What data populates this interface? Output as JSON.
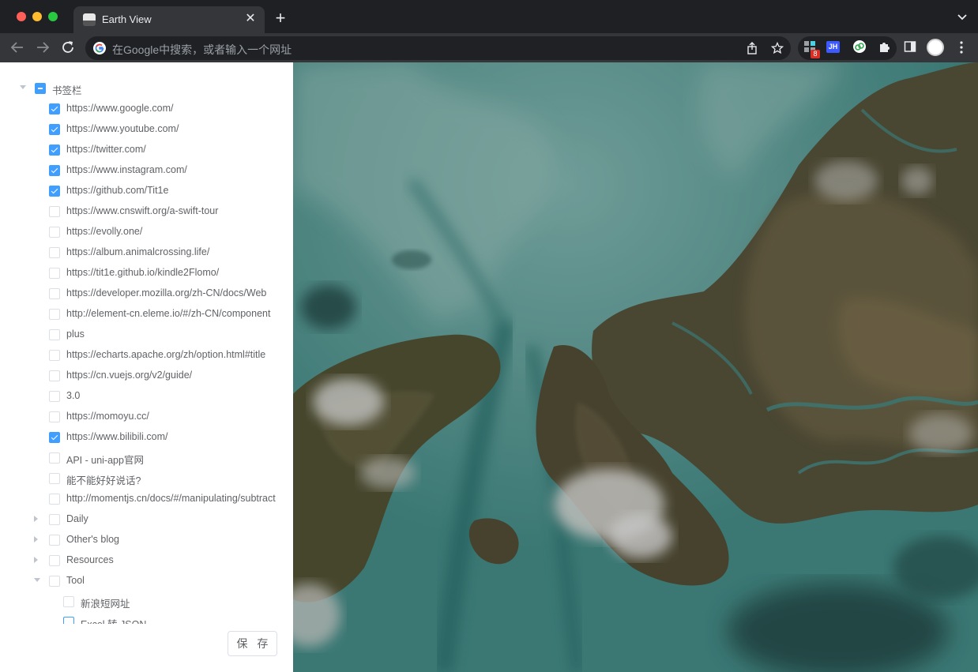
{
  "browser": {
    "tab_title": "Earth View",
    "tab_close": "✕",
    "new_tab": "+",
    "omnibox_placeholder": "在Google中搜索，或者输入一个网址",
    "extension_badge": "8",
    "jh_label": "JH"
  },
  "tree": {
    "root": {
      "label": "书签栏",
      "state": "indeterminate",
      "expanded": true
    },
    "bookmarks": [
      {
        "label": "https://www.google.com/",
        "checked": true
      },
      {
        "label": "https://www.youtube.com/",
        "checked": true
      },
      {
        "label": "https://twitter.com/",
        "checked": true
      },
      {
        "label": "https://www.instagram.com/",
        "checked": true
      },
      {
        "label": "https://github.com/Tit1e",
        "checked": true
      },
      {
        "label": "https://www.cnswift.org/a-swift-tour",
        "checked": false
      },
      {
        "label": "https://evolly.one/",
        "checked": false
      },
      {
        "label": "https://album.animalcrossing.life/",
        "checked": false
      },
      {
        "label": "https://tit1e.github.io/kindle2Flomo/",
        "checked": false
      },
      {
        "label": "https://developer.mozilla.org/zh-CN/docs/Web",
        "checked": false
      },
      {
        "label": "http://element-cn.eleme.io/#/zh-CN/component",
        "checked": false
      },
      {
        "label": "plus",
        "checked": false
      },
      {
        "label": "https://echarts.apache.org/zh/option.html#title",
        "checked": false
      },
      {
        "label": "https://cn.vuejs.org/v2/guide/",
        "checked": false
      },
      {
        "label": "3.0",
        "checked": false
      },
      {
        "label": "https://momoyu.cc/",
        "checked": false
      },
      {
        "label": "https://www.bilibili.com/",
        "checked": true
      },
      {
        "label": "API - uni-app官网",
        "checked": false
      },
      {
        "label": "能不能好好说话?",
        "checked": false
      },
      {
        "label": "http://momentjs.cn/docs/#/manipulating/subtract",
        "checked": false
      }
    ],
    "folders": [
      {
        "label": "Daily",
        "expanded": false
      },
      {
        "label": "Other's blog",
        "expanded": false
      },
      {
        "label": "Resources",
        "expanded": false
      },
      {
        "label": "Tool",
        "expanded": true
      }
    ],
    "tool_children": [
      {
        "label": "新浪短网址",
        "checked": false
      },
      {
        "label": "Excel 转 JSON",
        "checked": false
      }
    ]
  },
  "save_button": "保 存",
  "colors": {
    "accent": "#409eff",
    "panel_bg": "#ffffff",
    "chrome_dark": "#1f2023",
    "toolbar": "#35363a"
  }
}
